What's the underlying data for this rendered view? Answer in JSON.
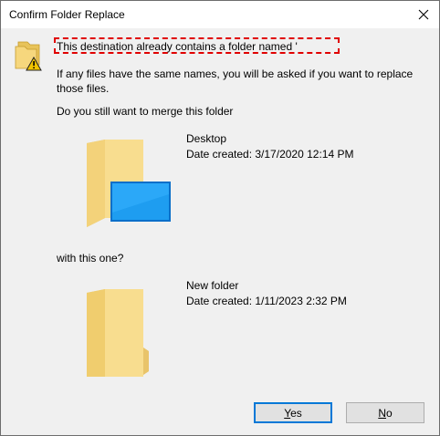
{
  "window": {
    "title": "Confirm Folder Replace"
  },
  "message": {
    "headline": "This destination already contains a folder named '",
    "detail": "If any files have the same names, you will be asked if you want to replace those files.",
    "question": "Do you still want to merge this folder"
  },
  "source_folder": {
    "name": "Desktop",
    "date_created": "Date created: 3/17/2020 12:14 PM"
  },
  "connector_text": "with this one?",
  "target_folder": {
    "name": "New folder",
    "date_created": "Date created: 1/11/2023 2:32 PM"
  },
  "buttons": {
    "yes_label": "Yes",
    "no_label": "No"
  },
  "icons": {
    "close": "close-icon",
    "warning": "folder-warning-icon",
    "source": "desktop-folder-icon",
    "target": "folder-icon"
  },
  "colors": {
    "highlight": "#e00000",
    "default_button_border": "#0078d7",
    "folder": "#f5d77b"
  }
}
